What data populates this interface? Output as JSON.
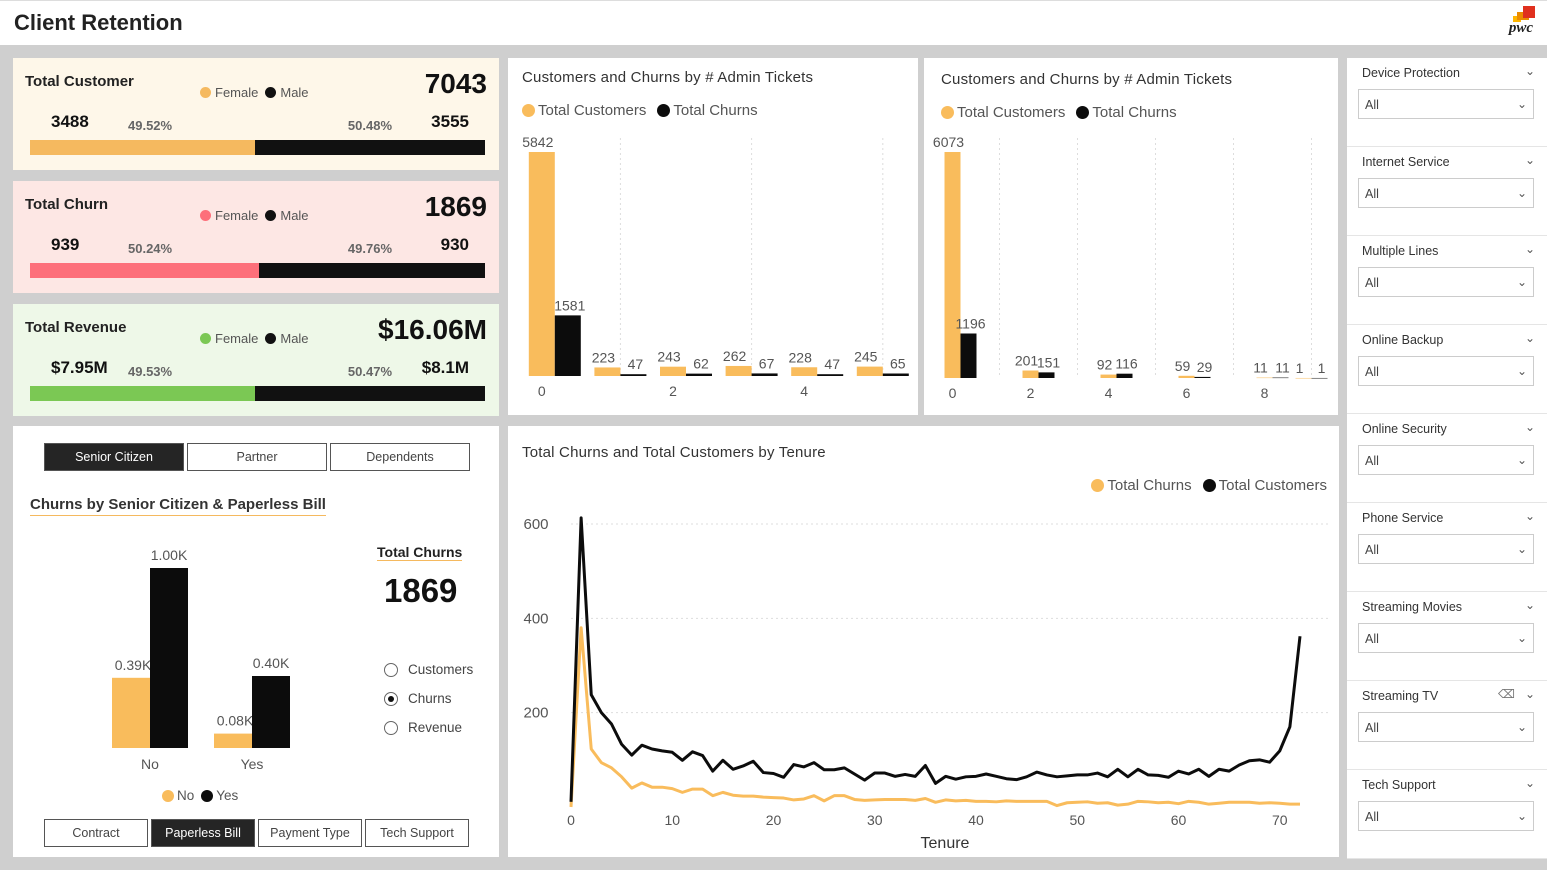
{
  "header": {
    "title": "Client Retention",
    "logo_text": "pwc"
  },
  "kpis": [
    {
      "name": "Total Customer",
      "total": "7043",
      "female": "3488",
      "male": "3555",
      "female_pct": "49.52%",
      "male_pct": "50.48%",
      "female_label": "Female",
      "male_label": "Male",
      "female_color": "#f5b95f",
      "female_share": 0.4952
    },
    {
      "name": "Total Churn",
      "total": "1869",
      "female": "939",
      "male": "930",
      "female_pct": "50.24%",
      "male_pct": "49.76%",
      "female_label": "Female",
      "male_label": "Male",
      "female_color": "#fd6f7a",
      "female_share": 0.5024
    },
    {
      "name": "Total Revenue",
      "total": "$16.06M",
      "female": "$7.95M",
      "male": "$8.1M",
      "female_pct": "49.53%",
      "male_pct": "50.47%",
      "female_label": "Female",
      "male_label": "Male",
      "female_color": "#7bc854",
      "female_share": 0.4953
    }
  ],
  "colors": {
    "orange": "#f9bc5c",
    "black": "#0c0c0c"
  },
  "admin_chart_1": {
    "title": "Customers and Churns by # Admin Tickets",
    "legend": [
      "Total Customers",
      "Total Churns"
    ]
  },
  "admin_chart_2": {
    "title": "Customers and Churns by # Admin Tickets",
    "legend": [
      "Total Customers",
      "Total Churns"
    ]
  },
  "tenure_chart": {
    "title": "Total Churns and Total Customers by Tenure",
    "legend": [
      "Total Churns",
      "Total Customers"
    ]
  },
  "segment_tabs": [
    {
      "label": "Senior Citizen",
      "active": true
    },
    {
      "label": "Partner",
      "active": false
    },
    {
      "label": "Dependents",
      "active": false
    }
  ],
  "bottom_tabs": [
    {
      "label": "Contract",
      "active": false
    },
    {
      "label": "Paperless Bill",
      "active": true
    },
    {
      "label": "Payment Type",
      "active": false
    },
    {
      "label": "Tech Support",
      "active": false
    }
  ],
  "senior_chart": {
    "title_parts": [
      "Churns",
      "by",
      "Senior Citizen",
      "&",
      "Paperless Bill"
    ],
    "legend": [
      "No",
      "Yes"
    ]
  },
  "total_churns": {
    "label_parts": [
      "Total",
      "Churns"
    ],
    "value": "1869"
  },
  "radios": [
    {
      "label": "Customers",
      "selected": false
    },
    {
      "label": "Churns",
      "selected": true
    },
    {
      "label": "Revenue",
      "selected": false
    }
  ],
  "slicers": [
    {
      "name": "Device Protection",
      "value": "All"
    },
    {
      "name": "Internet Service",
      "value": "All"
    },
    {
      "name": "Multiple Lines",
      "value": "All"
    },
    {
      "name": "Online Backup",
      "value": "All"
    },
    {
      "name": "Online Security",
      "value": "All"
    },
    {
      "name": "Phone Service",
      "value": "All"
    },
    {
      "name": "Streaming Movies",
      "value": "All"
    },
    {
      "name": "Streaming TV",
      "value": "All",
      "has_eraser": true
    },
    {
      "name": "Tech Support",
      "value": "All"
    }
  ],
  "chart_data": [
    {
      "type": "bar",
      "title": "Customers and Churns by # Admin Tickets",
      "categories": [
        "0",
        "1",
        "2",
        "3",
        "4",
        "5"
      ],
      "x_tick_labels": [
        "0",
        "2",
        "4"
      ],
      "series": [
        {
          "name": "Total Customers",
          "values": [
            5842,
            223,
            243,
            262,
            228,
            245
          ]
        },
        {
          "name": "Total Churns",
          "values": [
            1581,
            47,
            62,
            67,
            47,
            65
          ]
        }
      ]
    },
    {
      "type": "bar",
      "title": "Customers and Churns by # Admin Tickets",
      "categories": [
        "0",
        "1",
        "2",
        "3",
        "4",
        "5",
        "6",
        "7",
        "8",
        "9"
      ],
      "x_tick_labels": [
        "0",
        "2",
        "4",
        "6",
        "8"
      ],
      "series": [
        {
          "name": "Total Customers",
          "values": [
            6073,
            null,
            201,
            null,
            92,
            null,
            59,
            null,
            11,
            1
          ]
        },
        {
          "name": "Total Churns",
          "values": [
            1196,
            null,
            151,
            null,
            116,
            null,
            29,
            null,
            11,
            1
          ]
        }
      ]
    },
    {
      "type": "bar",
      "title": "Churns by Senior Citizen & Paperless Bill",
      "categories": [
        "No",
        "Yes"
      ],
      "series": [
        {
          "name": "No",
          "values": [
            0.39,
            0.08
          ],
          "labels": [
            "0.39K",
            "0.08K"
          ]
        },
        {
          "name": "Yes",
          "values": [
            1.0,
            0.4
          ],
          "labels": [
            "1.00K",
            "0.40K"
          ]
        }
      ]
    },
    {
      "type": "line",
      "title": "Total Churns and Total Customers by Tenure",
      "xlabel": "Tenure",
      "x_ticks": [
        0,
        10,
        20,
        30,
        40,
        50,
        60,
        70
      ],
      "y_ticks": [
        200,
        400,
        600
      ],
      "xlim": [
        0,
        72
      ],
      "ylim": [
        0,
        600
      ],
      "series": [
        {
          "name": "Total Churns",
          "x": [
            0,
            1,
            2,
            3,
            4,
            5,
            6,
            7,
            8,
            9,
            10,
            11,
            12,
            13,
            14,
            15,
            16,
            17,
            18,
            19,
            20,
            21,
            22,
            23,
            24,
            25,
            26,
            27,
            28,
            29,
            30,
            31,
            32,
            33,
            34,
            35,
            36,
            37,
            38,
            39,
            40,
            41,
            42,
            43,
            44,
            45,
            46,
            47,
            48,
            49,
            50,
            51,
            52,
            53,
            54,
            55,
            56,
            57,
            58,
            59,
            60,
            61,
            62,
            63,
            64,
            65,
            66,
            67,
            68,
            69,
            70,
            71,
            72
          ],
          "y": [
            0,
            380,
            123,
            94,
            83,
            64,
            40,
            51,
            42,
            42,
            39,
            31,
            38,
            38,
            24,
            31,
            25,
            23,
            23,
            21,
            20,
            19,
            15,
            17,
            24,
            13,
            24,
            24,
            16,
            14,
            15,
            16,
            16,
            16,
            14,
            18,
            10,
            15,
            13,
            14,
            12,
            12,
            11,
            13,
            12,
            12,
            12,
            12,
            3,
            9,
            10,
            11,
            8,
            9,
            4,
            6,
            12,
            11,
            9,
            10,
            7,
            12,
            10,
            6,
            8,
            10,
            10,
            10,
            8,
            9,
            8,
            6,
            6
          ]
        },
        {
          "name": "Total Customers",
          "x": [
            0,
            1,
            2,
            3,
            4,
            5,
            6,
            7,
            8,
            9,
            10,
            11,
            12,
            13,
            14,
            15,
            16,
            17,
            18,
            19,
            20,
            21,
            22,
            23,
            24,
            25,
            26,
            27,
            28,
            29,
            30,
            31,
            32,
            33,
            34,
            35,
            36,
            37,
            38,
            39,
            40,
            41,
            42,
            43,
            44,
            45,
            46,
            47,
            48,
            49,
            50,
            51,
            52,
            53,
            54,
            55,
            56,
            57,
            58,
            59,
            60,
            61,
            62,
            63,
            64,
            65,
            66,
            67,
            68,
            69,
            70,
            71,
            72
          ],
          "y": [
            11,
            613,
            238,
            200,
            176,
            133,
            110,
            131,
            123,
            119,
            116,
            99,
            117,
            109,
            76,
            99,
            80,
            87,
            97,
            73,
            71,
            63,
            90,
            85,
            94,
            79,
            79,
            83,
            70,
            57,
            72,
            72,
            65,
            69,
            65,
            88,
            50,
            65,
            59,
            64,
            65,
            70,
            65,
            60,
            58,
            64,
            74,
            68,
            64,
            66,
            68,
            68,
            72,
            64,
            80,
            64,
            80,
            68,
            67,
            63,
            76,
            70,
            80,
            65,
            80,
            76,
            89,
            98,
            100,
            95,
            119,
            170,
            362
          ]
        }
      ]
    }
  ]
}
